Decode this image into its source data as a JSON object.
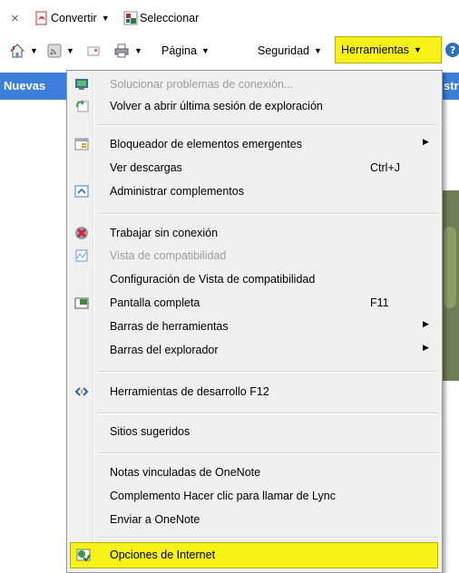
{
  "toolbar_row1": {
    "close_glyph": "×",
    "convertir_label": "Convertir",
    "caret": "▼",
    "seleccionar_label": "Seleccionar"
  },
  "toolbar_row2": {
    "caret": "▼",
    "pagina_label": "Página",
    "seguridad_label": "Seguridad",
    "herramientas_label": "Herramientas"
  },
  "tabbar": {
    "left_text": "Nuevas",
    "right_text": "stra"
  },
  "menu": {
    "items": [
      {
        "label": "Solucionar problemas de conexión...",
        "icon": "network-diagnose-icon",
        "disabled": true
      },
      {
        "label": "Volver a abrir última sesión de exploración",
        "icon": "reopen-session-icon"
      },
      {
        "label": "Bloqueador de elementos emergentes",
        "icon": "popup-blocker-icon",
        "submenu": "▶"
      },
      {
        "label": "Ver descargas",
        "shortcut": "Ctrl+J"
      },
      {
        "label": "Administrar complementos",
        "icon": "addons-icon"
      },
      {
        "label": "Trabajar sin conexión",
        "icon": "offline-icon"
      },
      {
        "label": "Vista de compatibilidad",
        "icon": "compat-view-icon",
        "disabled": true
      },
      {
        "label": "Configuración de Vista de compatibilidad"
      },
      {
        "label": "Pantalla completa",
        "icon": "fullscreen-icon",
        "shortcut": "F11"
      },
      {
        "label": "Barras de herramientas",
        "submenu": "▶"
      },
      {
        "label": "Barras del explorador",
        "submenu": "▶"
      },
      {
        "label": "Herramientas de desarrollo F12",
        "icon": "dev-tools-icon"
      },
      {
        "label": "Sitios sugeridos"
      },
      {
        "label": "Notas vinculadas de OneNote"
      },
      {
        "label": "Complemento Hacer clic para llamar de Lync"
      },
      {
        "label": "Enviar a OneNote"
      },
      {
        "label": "Opciones de Internet",
        "icon": "internet-options-icon"
      }
    ]
  },
  "colors": {
    "highlight": "#f6f218",
    "tabbar": "#3b7fdb",
    "menu_bg": "#f0f0f0"
  }
}
